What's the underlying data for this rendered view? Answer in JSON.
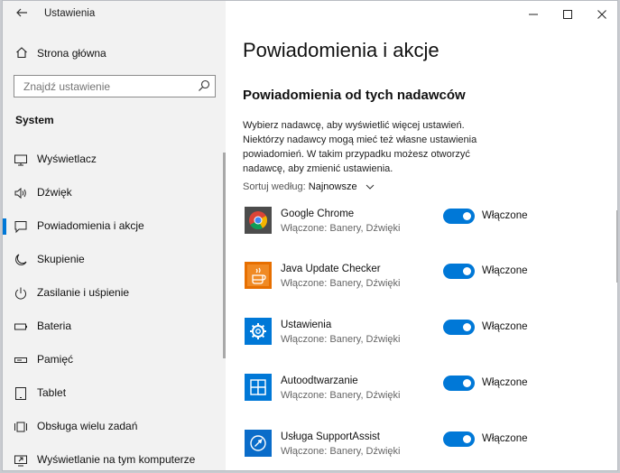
{
  "window": {
    "app_title": "Ustawienia"
  },
  "sidebar": {
    "home_label": "Strona główna",
    "search_placeholder": "Znajdź ustawienie",
    "section_title": "System",
    "items": [
      {
        "label": "Wyświetlacz",
        "icon": "display-icon"
      },
      {
        "label": "Dźwięk",
        "icon": "speaker-icon"
      },
      {
        "label": "Powiadomienia i akcje",
        "icon": "notification-icon"
      },
      {
        "label": "Skupienie",
        "icon": "moon-icon"
      },
      {
        "label": "Zasilanie i uśpienie",
        "icon": "power-icon"
      },
      {
        "label": "Bateria",
        "icon": "battery-icon"
      },
      {
        "label": "Pamięć",
        "icon": "storage-icon"
      },
      {
        "label": "Tablet",
        "icon": "tablet-icon"
      },
      {
        "label": "Obsługa wielu zadań",
        "icon": "multitasking-icon"
      },
      {
        "label": "Wyświetlanie na tym komputerze",
        "icon": "project-icon"
      }
    ],
    "active_index": 2
  },
  "main": {
    "page_title": "Powiadomienia i akcje",
    "section_title": "Powiadomienia od tych nadawców",
    "description": "Wybierz nadawcę, aby wyświetlić więcej ustawień. Niektórzy nadawcy mogą mieć też własne ustawienia powiadomień. W takim przypadku możesz otworzyć nadawcę, aby zmienić ustawienia.",
    "sort_label": "Sortuj według:",
    "sort_value": "Najnowsze",
    "senders": [
      {
        "name": "Google Chrome",
        "status": "Włączone: Banery, Dźwięki",
        "toggle_label": "Włączone",
        "on": true
      },
      {
        "name": "Java Update Checker",
        "status": "Włączone: Banery, Dźwięki",
        "toggle_label": "Włączone",
        "on": true
      },
      {
        "name": "Ustawienia",
        "status": "Włączone: Banery, Dźwięki",
        "toggle_label": "Włączone",
        "on": true
      },
      {
        "name": "Autoodtwarzanie",
        "status": "Włączone: Banery, Dźwięki",
        "toggle_label": "Włączone",
        "on": true
      },
      {
        "name": "Usługa SupportAssist",
        "status": "Włączone: Banery, Dźwięki",
        "toggle_label": "Włączone",
        "on": true
      }
    ]
  },
  "colors": {
    "accent": "#0078d7",
    "sidebar_bg": "#f2f2f2",
    "java_orange": "#e76f00"
  }
}
